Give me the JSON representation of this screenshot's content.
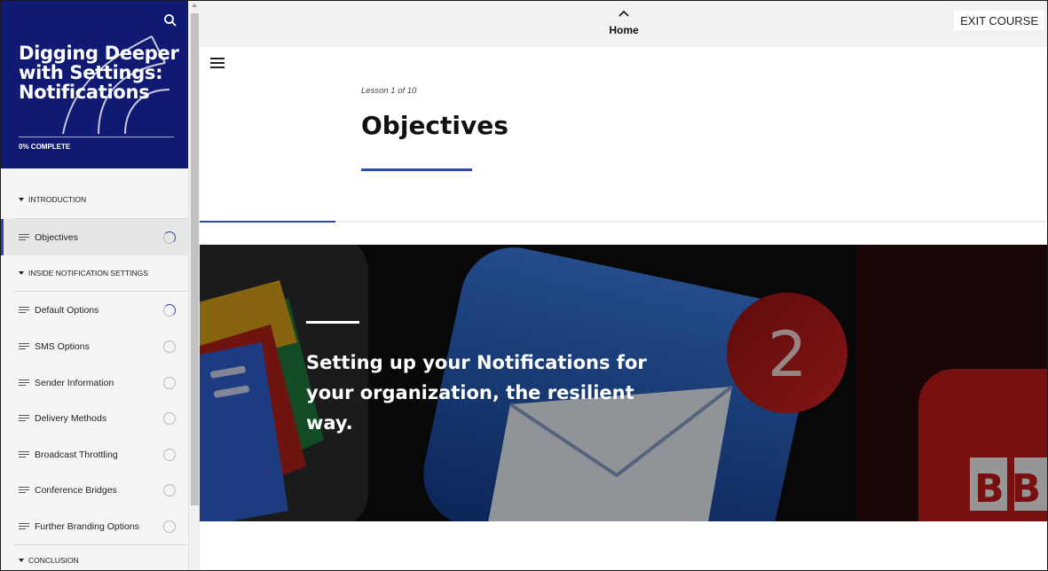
{
  "course": {
    "title": "Digging Deeper with Settings: Notifications",
    "progress_label": "0% COMPLETE"
  },
  "sidebar": {
    "sections": [
      {
        "label": "INTRODUCTION"
      },
      {
        "label": "INSIDE NOTIFICATION SETTINGS"
      },
      {
        "label": "CONCLUSION"
      }
    ],
    "items": [
      {
        "label": "Objectives",
        "status": "in-progress",
        "active": true
      },
      {
        "label": "Default Options",
        "status": "in-progress"
      },
      {
        "label": "SMS Options",
        "status": "not-started"
      },
      {
        "label": "Sender Information",
        "status": "not-started"
      },
      {
        "label": "Delivery Methods",
        "status": "not-started"
      },
      {
        "label": "Broadcast Throttling",
        "status": "not-started"
      },
      {
        "label": "Conference Bridges",
        "status": "not-started"
      },
      {
        "label": "Further Branding Options",
        "status": "not-started"
      }
    ]
  },
  "topbar": {
    "home_label": "Home",
    "exit_label": "EXIT COURSE"
  },
  "lesson": {
    "count_label": "Lesson 1 of 10",
    "title": "Objectives",
    "progress_fraction": 0.1
  },
  "hero": {
    "text": "Setting up your Notifications for your organization, the resilient way.",
    "badge_number": "2",
    "corner_letters": "BB"
  },
  "colors": {
    "sidebar_header": "#101a72",
    "accent": "#2c48b8",
    "badge_red": "#d7261e"
  },
  "icons": [
    "search-icon",
    "menu-icon",
    "chevron-up-icon",
    "list-lines-icon",
    "status-circle-icon"
  ]
}
